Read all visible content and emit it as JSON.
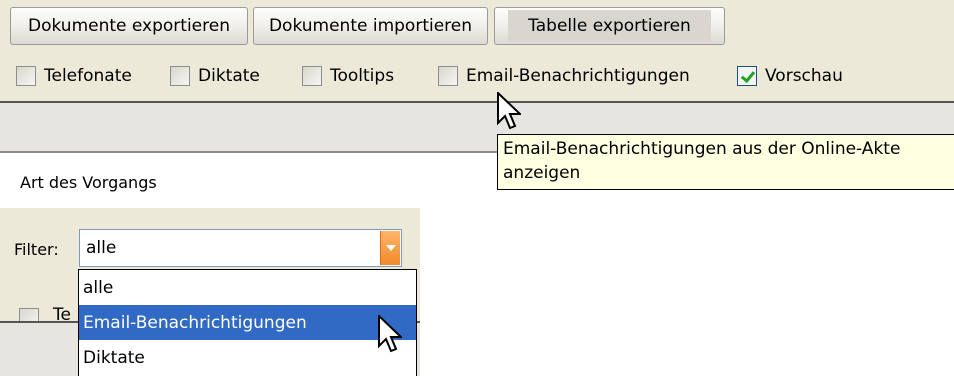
{
  "toolbar": {
    "export_docs_label": "Dokumente exportieren",
    "import_docs_label": "Dokumente importieren",
    "export_table_label": "Tabelle exportieren"
  },
  "checkboxes": [
    {
      "label": "Telefonate",
      "checked": false
    },
    {
      "label": "Diktate",
      "checked": false
    },
    {
      "label": "Tooltips",
      "checked": false
    },
    {
      "label": "Email-Benachrichtigungen",
      "checked": false
    },
    {
      "label": "Vorschau",
      "checked": true
    }
  ],
  "tooltip": {
    "line1": "Email-Benachrichtigungen aus der Online-Akte",
    "line2": "anzeigen"
  },
  "table": {
    "column_header": "Art des Vorgangs"
  },
  "filter": {
    "label": "Filter:",
    "value": "alle",
    "options": [
      "alle",
      "Email-Benachrichtigungen",
      "Diktate"
    ],
    "selected_option": "Email-Benachrichtigungen"
  },
  "lower_row": {
    "partial_label": "Te"
  },
  "colors": {
    "panel_bg": "#ece9d8",
    "tooltip_bg": "#ffffe1",
    "selection": "#316ac5",
    "dropdown_button": "#f08a2c"
  },
  "icons": [
    "mouse-cursor-icon",
    "dropdown-arrow-icon",
    "checkmark-icon"
  ]
}
